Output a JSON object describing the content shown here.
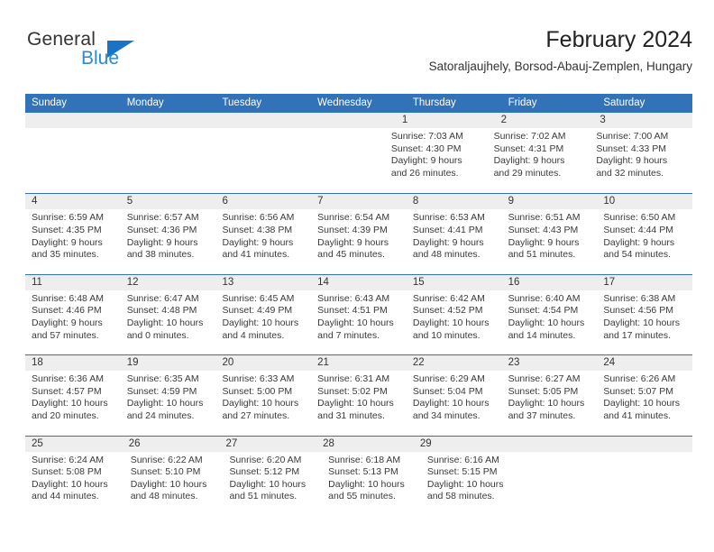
{
  "brand": {
    "name_top": "General",
    "name_bottom": "Blue",
    "triangle_color": "#1a73c4",
    "blue_color": "#2b8ad4"
  },
  "header": {
    "title": "February 2024",
    "subtitle": "Satoraljaujhely, Borsod-Abauj-Zemplen, Hungary"
  },
  "theme": {
    "header_blue": "#3172b9",
    "daynum_band": "#eeeeee",
    "text": "#3a3a3a"
  },
  "calendar": {
    "weekdays": [
      "Sunday",
      "Monday",
      "Tuesday",
      "Wednesday",
      "Thursday",
      "Friday",
      "Saturday"
    ],
    "weeks": [
      [
        {
          "empty": true
        },
        {
          "empty": true
        },
        {
          "empty": true
        },
        {
          "empty": true
        },
        {
          "day": "1",
          "sunrise": "Sunrise: 7:03 AM",
          "sunset": "Sunset: 4:30 PM",
          "daylight1": "Daylight: 9 hours",
          "daylight2": "and 26 minutes."
        },
        {
          "day": "2",
          "sunrise": "Sunrise: 7:02 AM",
          "sunset": "Sunset: 4:31 PM",
          "daylight1": "Daylight: 9 hours",
          "daylight2": "and 29 minutes."
        },
        {
          "day": "3",
          "sunrise": "Sunrise: 7:00 AM",
          "sunset": "Sunset: 4:33 PM",
          "daylight1": "Daylight: 9 hours",
          "daylight2": "and 32 minutes."
        }
      ],
      [
        {
          "day": "4",
          "sunrise": "Sunrise: 6:59 AM",
          "sunset": "Sunset: 4:35 PM",
          "daylight1": "Daylight: 9 hours",
          "daylight2": "and 35 minutes."
        },
        {
          "day": "5",
          "sunrise": "Sunrise: 6:57 AM",
          "sunset": "Sunset: 4:36 PM",
          "daylight1": "Daylight: 9 hours",
          "daylight2": "and 38 minutes."
        },
        {
          "day": "6",
          "sunrise": "Sunrise: 6:56 AM",
          "sunset": "Sunset: 4:38 PM",
          "daylight1": "Daylight: 9 hours",
          "daylight2": "and 41 minutes."
        },
        {
          "day": "7",
          "sunrise": "Sunrise: 6:54 AM",
          "sunset": "Sunset: 4:39 PM",
          "daylight1": "Daylight: 9 hours",
          "daylight2": "and 45 minutes."
        },
        {
          "day": "8",
          "sunrise": "Sunrise: 6:53 AM",
          "sunset": "Sunset: 4:41 PM",
          "daylight1": "Daylight: 9 hours",
          "daylight2": "and 48 minutes."
        },
        {
          "day": "9",
          "sunrise": "Sunrise: 6:51 AM",
          "sunset": "Sunset: 4:43 PM",
          "daylight1": "Daylight: 9 hours",
          "daylight2": "and 51 minutes."
        },
        {
          "day": "10",
          "sunrise": "Sunrise: 6:50 AM",
          "sunset": "Sunset: 4:44 PM",
          "daylight1": "Daylight: 9 hours",
          "daylight2": "and 54 minutes."
        }
      ],
      [
        {
          "day": "11",
          "sunrise": "Sunrise: 6:48 AM",
          "sunset": "Sunset: 4:46 PM",
          "daylight1": "Daylight: 9 hours",
          "daylight2": "and 57 minutes."
        },
        {
          "day": "12",
          "sunrise": "Sunrise: 6:47 AM",
          "sunset": "Sunset: 4:48 PM",
          "daylight1": "Daylight: 10 hours",
          "daylight2": "and 0 minutes."
        },
        {
          "day": "13",
          "sunrise": "Sunrise: 6:45 AM",
          "sunset": "Sunset: 4:49 PM",
          "daylight1": "Daylight: 10 hours",
          "daylight2": "and 4 minutes."
        },
        {
          "day": "14",
          "sunrise": "Sunrise: 6:43 AM",
          "sunset": "Sunset: 4:51 PM",
          "daylight1": "Daylight: 10 hours",
          "daylight2": "and 7 minutes."
        },
        {
          "day": "15",
          "sunrise": "Sunrise: 6:42 AM",
          "sunset": "Sunset: 4:52 PM",
          "daylight1": "Daylight: 10 hours",
          "daylight2": "and 10 minutes."
        },
        {
          "day": "16",
          "sunrise": "Sunrise: 6:40 AM",
          "sunset": "Sunset: 4:54 PM",
          "daylight1": "Daylight: 10 hours",
          "daylight2": "and 14 minutes."
        },
        {
          "day": "17",
          "sunrise": "Sunrise: 6:38 AM",
          "sunset": "Sunset: 4:56 PM",
          "daylight1": "Daylight: 10 hours",
          "daylight2": "and 17 minutes."
        }
      ],
      [
        {
          "day": "18",
          "sunrise": "Sunrise: 6:36 AM",
          "sunset": "Sunset: 4:57 PM",
          "daylight1": "Daylight: 10 hours",
          "daylight2": "and 20 minutes."
        },
        {
          "day": "19",
          "sunrise": "Sunrise: 6:35 AM",
          "sunset": "Sunset: 4:59 PM",
          "daylight1": "Daylight: 10 hours",
          "daylight2": "and 24 minutes."
        },
        {
          "day": "20",
          "sunrise": "Sunrise: 6:33 AM",
          "sunset": "Sunset: 5:00 PM",
          "daylight1": "Daylight: 10 hours",
          "daylight2": "and 27 minutes."
        },
        {
          "day": "21",
          "sunrise": "Sunrise: 6:31 AM",
          "sunset": "Sunset: 5:02 PM",
          "daylight1": "Daylight: 10 hours",
          "daylight2": "and 31 minutes."
        },
        {
          "day": "22",
          "sunrise": "Sunrise: 6:29 AM",
          "sunset": "Sunset: 5:04 PM",
          "daylight1": "Daylight: 10 hours",
          "daylight2": "and 34 minutes."
        },
        {
          "day": "23",
          "sunrise": "Sunrise: 6:27 AM",
          "sunset": "Sunset: 5:05 PM",
          "daylight1": "Daylight: 10 hours",
          "daylight2": "and 37 minutes."
        },
        {
          "day": "24",
          "sunrise": "Sunrise: 6:26 AM",
          "sunset": "Sunset: 5:07 PM",
          "daylight1": "Daylight: 10 hours",
          "daylight2": "and 41 minutes."
        }
      ],
      [
        {
          "day": "25",
          "sunrise": "Sunrise: 6:24 AM",
          "sunset": "Sunset: 5:08 PM",
          "daylight1": "Daylight: 10 hours",
          "daylight2": "and 44 minutes."
        },
        {
          "day": "26",
          "sunrise": "Sunrise: 6:22 AM",
          "sunset": "Sunset: 5:10 PM",
          "daylight1": "Daylight: 10 hours",
          "daylight2": "and 48 minutes."
        },
        {
          "day": "27",
          "sunrise": "Sunrise: 6:20 AM",
          "sunset": "Sunset: 5:12 PM",
          "daylight1": "Daylight: 10 hours",
          "daylight2": "and 51 minutes."
        },
        {
          "day": "28",
          "sunrise": "Sunrise: 6:18 AM",
          "sunset": "Sunset: 5:13 PM",
          "daylight1": "Daylight: 10 hours",
          "daylight2": "and 55 minutes."
        },
        {
          "day": "29",
          "sunrise": "Sunrise: 6:16 AM",
          "sunset": "Sunset: 5:15 PM",
          "daylight1": "Daylight: 10 hours",
          "daylight2": "and 58 minutes."
        },
        {
          "empty": true
        },
        {
          "empty": true
        }
      ]
    ]
  }
}
